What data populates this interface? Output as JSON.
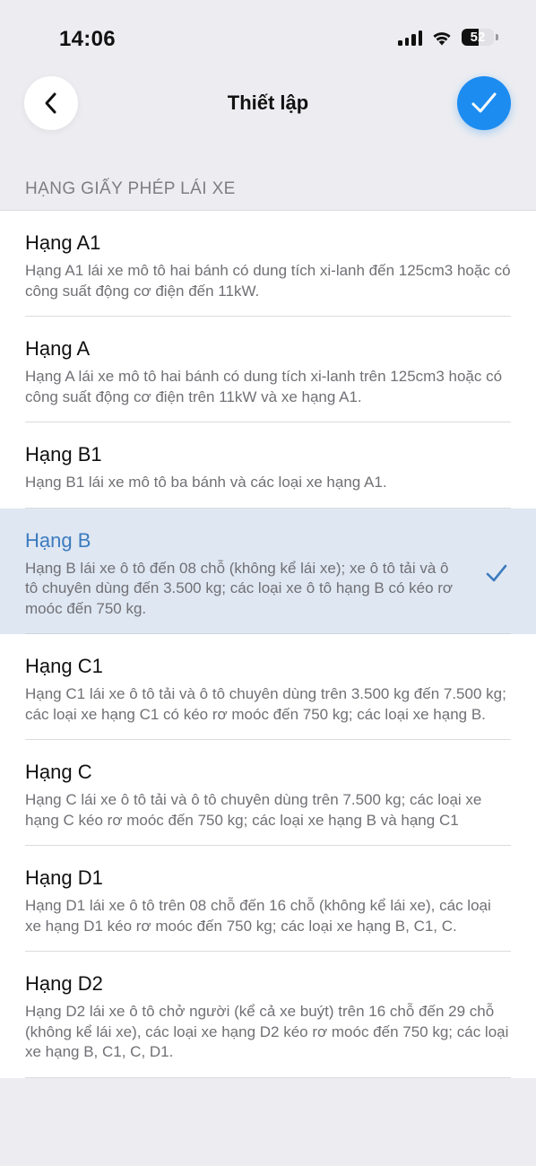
{
  "status": {
    "time": "14:06",
    "battery": "52",
    "battery_level": 0.52
  },
  "nav": {
    "title": "Thiết lập",
    "back_icon": "chevron-left-icon",
    "done_icon": "checkmark-icon",
    "accent": "#1d8cf0"
  },
  "section": {
    "header": "HẠNG GIẤY PHÉP LÁI XE"
  },
  "items": [
    {
      "title": "Hạng A1",
      "desc": "Hạng A1 lái xe mô tô hai bánh có dung tích xi-lanh đến 125cm3 hoặc có công suất động cơ điện đến 11kW.",
      "selected": false
    },
    {
      "title": "Hạng A",
      "desc": "Hạng A lái xe mô tô hai bánh có dung tích xi-lanh trên 125cm3 hoặc có công suất động cơ điện trên 11kW và xe hạng A1.",
      "selected": false
    },
    {
      "title": "Hạng B1",
      "desc": "Hạng B1 lái xe mô tô ba bánh và các loại xe hạng A1.",
      "selected": false
    },
    {
      "title": "Hạng B",
      "desc": "Hạng B lái xe ô tô đến 08 chỗ (không kể lái xe); xe ô tô tải và ô tô chuyên dùng đến 3.500 kg; các loại xe ô tô hạng B có kéo rơ moóc đến 750 kg.",
      "selected": true
    },
    {
      "title": "Hạng C1",
      "desc": "Hạng C1 lái xe ô tô tải và ô tô chuyên dùng trên 3.500 kg đến 7.500 kg; các loại xe hạng C1 có kéo rơ moóc đến 750 kg; các loại xe hạng B.",
      "selected": false
    },
    {
      "title": "Hạng C",
      "desc": "Hạng C lái xe ô tô tải và ô tô chuyên dùng trên 7.500 kg; các loại xe hạng C kéo rơ moóc đến 750 kg; các loại xe hạng B và hạng C1",
      "selected": false
    },
    {
      "title": "Hạng D1",
      "desc": "Hạng D1 lái xe ô tô trên 08 chỗ đến 16 chỗ (không kể lái xe), các loại xe hạng D1 kéo rơ moóc đến 750 kg; các loại xe hạng B, C1, C.",
      "selected": false
    },
    {
      "title": "Hạng D2",
      "desc": "Hạng D2 lái xe ô tô chở người (kể cả xe buýt) trên 16 chỗ đến 29 chỗ (không kể lái xe), các loại xe hạng D2 kéo rơ moóc đến 750 kg; các loại xe hạng B, C1, C, D1.",
      "selected": false
    }
  ]
}
